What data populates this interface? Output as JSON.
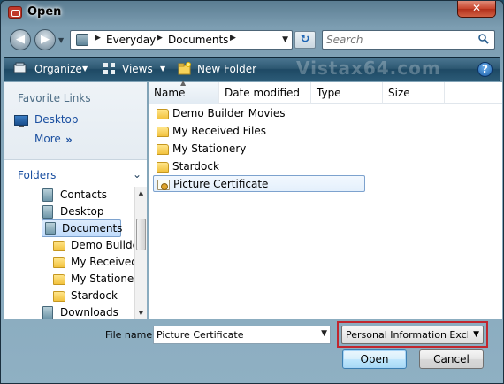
{
  "window": {
    "title": "Open",
    "close_glyph": "✕",
    "accent_color": "#1e4964",
    "highlight_color": "#c1262e"
  },
  "nav": {
    "back_glyph": "◀",
    "forward_glyph": "▶",
    "breadcrumbs": [
      "Everyday",
      "Documents"
    ],
    "refresh_glyph": "↻",
    "search_placeholder": "Search"
  },
  "toolbar": {
    "organize_label": "Organize",
    "views_label": "Views",
    "new_folder_label": "New Folder",
    "watermark": "Vistax64.com",
    "help_glyph": "?"
  },
  "left_pane": {
    "favorite_links_title": "Favorite Links",
    "favorites": [
      "Desktop"
    ],
    "more_label": "More",
    "more_chevron": "»",
    "folders_title": "Folders",
    "tree": [
      {
        "label": "Contacts",
        "icon": "user-folder-icon",
        "selected": false
      },
      {
        "label": "Desktop",
        "icon": "user-folder-icon",
        "selected": false
      },
      {
        "label": "Documents",
        "icon": "user-folder-icon",
        "selected": true
      },
      {
        "label": "Demo Builder Movies",
        "icon": "folder-icon",
        "selected": false
      },
      {
        "label": "My Received Files",
        "icon": "folder-icon",
        "selected": false
      },
      {
        "label": "My Stationery",
        "icon": "folder-icon",
        "selected": false
      },
      {
        "label": "Stardock",
        "icon": "folder-icon",
        "selected": false
      },
      {
        "label": "Downloads",
        "icon": "user-folder-icon",
        "selected": false
      }
    ]
  },
  "file_list": {
    "columns": [
      "Name",
      "Date modified",
      "Type",
      "Size"
    ],
    "items": [
      {
        "name": "Demo Builder Movies",
        "icon": "folder-icon"
      },
      {
        "name": "My Received Files",
        "icon": "folder-icon"
      },
      {
        "name": "My Stationery",
        "icon": "folder-icon"
      },
      {
        "name": "Stardock",
        "icon": "folder-icon"
      },
      {
        "name": "Picture Certificate",
        "icon": "certificate-icon",
        "selected": true
      }
    ]
  },
  "bottom": {
    "file_name_label": "File name:",
    "file_name_value": "Picture Certificate",
    "file_type_value": "Personal Information Exchange",
    "open_label": "Open",
    "cancel_label": "Cancel"
  }
}
